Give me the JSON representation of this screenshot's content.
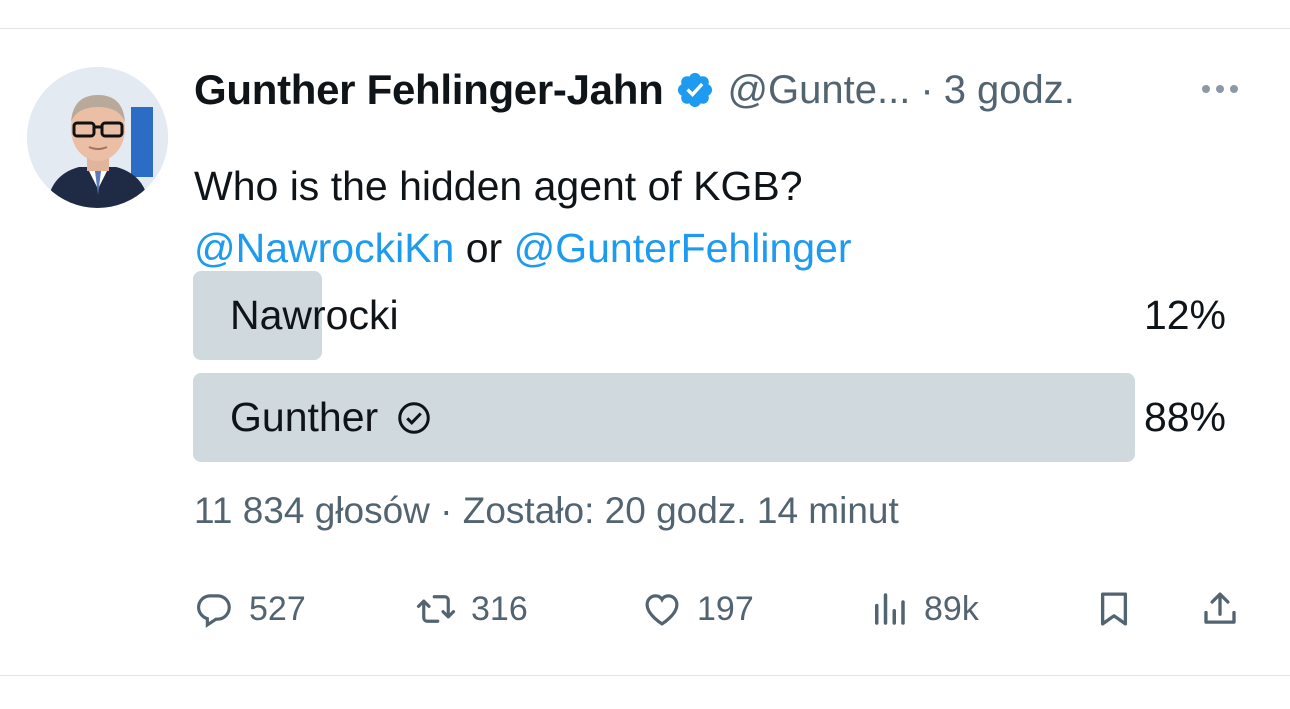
{
  "author": {
    "name": "Gunther Fehlinger-Jahn",
    "handle": "@Gunte...",
    "separator": "·",
    "time": "3 godz.",
    "verified_color": "#1d9bf0"
  },
  "tweet": {
    "text_line1": "Who is the hidden agent of KGB?",
    "mention1": "@NawrockiKn",
    "connector": " or ",
    "mention2": "@GunterFehlinger",
    "mention_color": "#1d9bf0"
  },
  "poll": {
    "options": [
      {
        "label": "Nawrocki",
        "percent": "12%",
        "fill_fraction": 0.12,
        "selected": false
      },
      {
        "label": "Gunther",
        "percent": "88%",
        "fill_fraction": 0.88,
        "selected": true,
        "selected_icon": "check-circle-icon"
      }
    ],
    "bar_color": "#cfd9de",
    "meta": "11 834 głosów · Zostało: 20 godz. 14 minut"
  },
  "actions": {
    "reply": {
      "icon": "reply-icon",
      "count": "527"
    },
    "retweet": {
      "icon": "retweet-icon",
      "count": "316"
    },
    "like": {
      "icon": "heart-icon",
      "count": "197"
    },
    "views": {
      "icon": "views-icon",
      "count": "89k"
    },
    "bookmark": {
      "icon": "bookmark-icon"
    },
    "share": {
      "icon": "share-icon"
    }
  }
}
